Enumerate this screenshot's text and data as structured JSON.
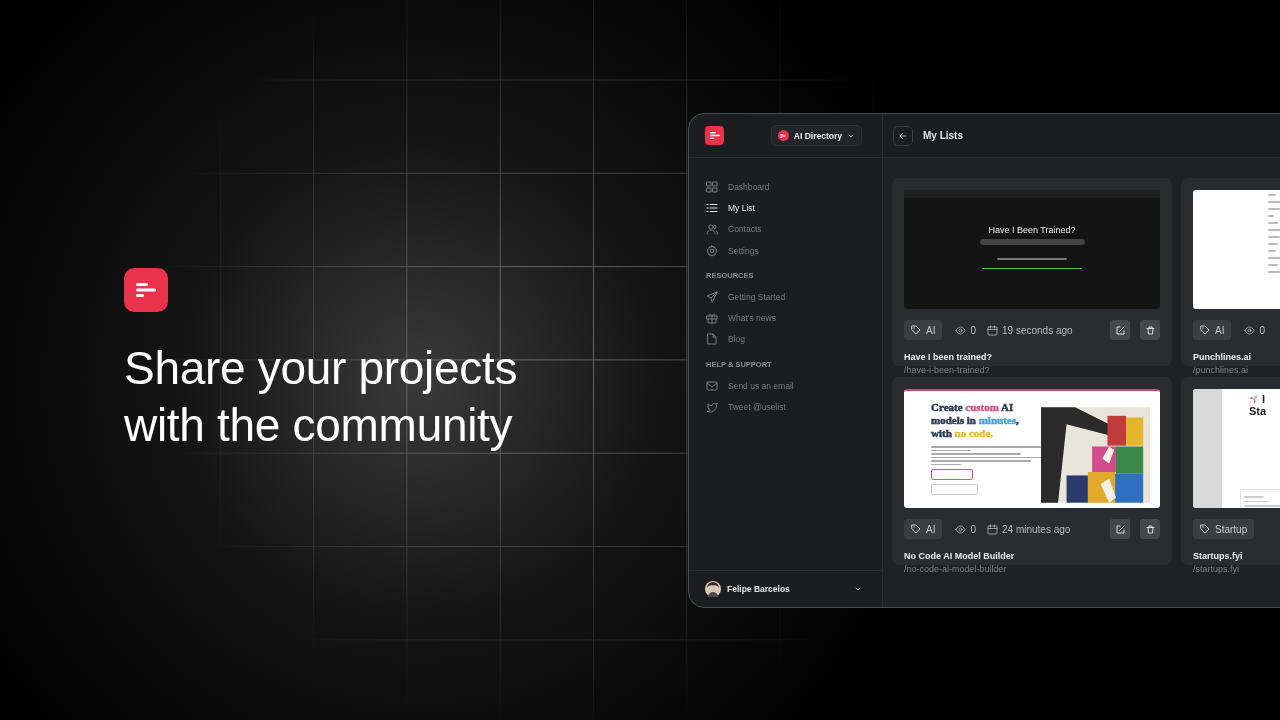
{
  "hero": {
    "headline": "Share your projects with the community"
  },
  "app": {
    "workspace": "AI Directory",
    "nav": [
      {
        "label": "Dashboard",
        "kind": "grid",
        "selected": false
      },
      {
        "label": "My List",
        "kind": "list",
        "selected": true
      },
      {
        "label": "Contacts",
        "kind": "users",
        "selected": false
      },
      {
        "label": "Settings",
        "kind": "gear",
        "selected": false
      }
    ],
    "sections": [
      {
        "title": "RESOURCES",
        "items": [
          {
            "label": "Getting Started",
            "kind": "send"
          },
          {
            "label": "What's news",
            "kind": "gift"
          },
          {
            "label": "Blog",
            "kind": "file"
          }
        ]
      },
      {
        "title": "HELP & SUPPORT",
        "items": [
          {
            "label": "Send us an email",
            "kind": "mail"
          },
          {
            "label": "Tweet @uselist",
            "kind": "bird"
          }
        ]
      }
    ],
    "user": {
      "name": "Felipe Barcelos"
    },
    "page_title": "My Lists",
    "cards": [
      {
        "tag": "AI",
        "views": "0",
        "time": "19 seconds ago",
        "title": "Have I been trained?",
        "slug": "/have-i-been-trained?",
        "thumb": {
          "kind": "dark-site",
          "heading": "Have I Been Trained?"
        }
      },
      {
        "tag": "AI",
        "views": "0",
        "title": "Punchlines.ai",
        "slug": "/punchlines.ai",
        "thumb": {
          "kind": "white-doc"
        }
      },
      {
        "tag": "AI",
        "views": "0",
        "time": "24 minutes ago",
        "title": "No Code AI Model Builder",
        "slug": "/no-code-ai-model-builder",
        "thumb": {
          "kind": "landing",
          "headline": [
            {
              "text": "Create ",
              "color": "#2b3a55"
            },
            {
              "text": "custom",
              "color": "#d2558a"
            },
            {
              "text": " AI models in ",
              "color": "#2b3a55"
            },
            {
              "text": "minutes",
              "color": "#4aa3d8"
            },
            {
              "text": ", with ",
              "color": "#2b3a55"
            },
            {
              "text": "no code.",
              "color": "#e8b93a"
            }
          ]
        }
      },
      {
        "tag": "Startup",
        "title": "Startups.fyi",
        "slug": "/startups.fyi",
        "thumb": {
          "kind": "startup",
          "heading": [
            "I",
            "Sta"
          ]
        }
      }
    ]
  }
}
